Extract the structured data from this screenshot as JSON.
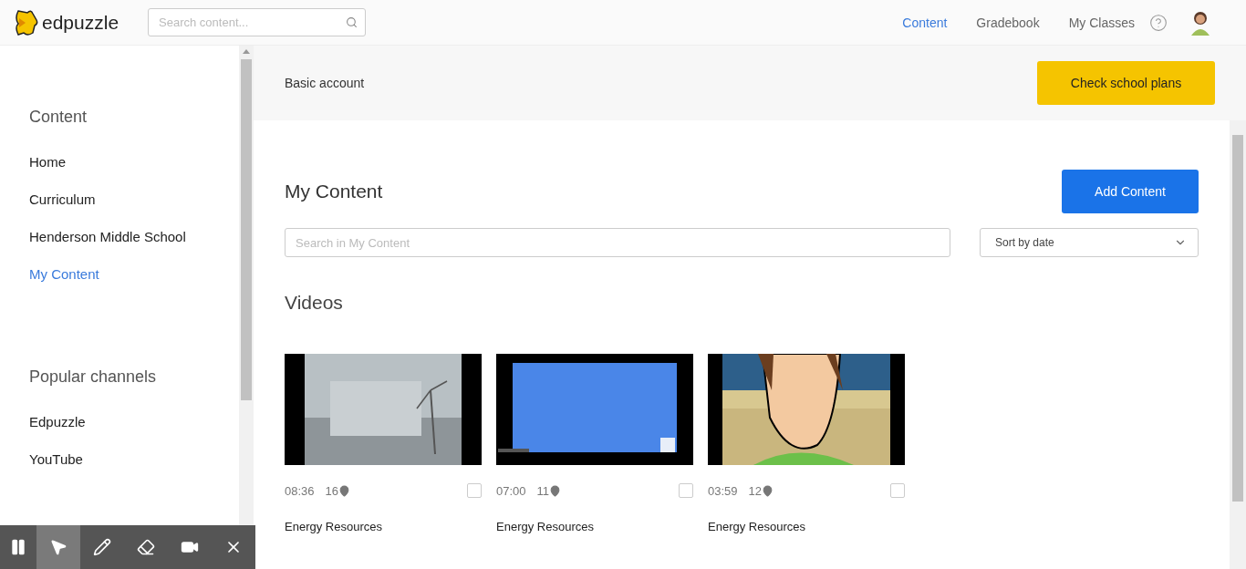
{
  "header": {
    "logo": "edpuzzle",
    "search": {
      "placeholder": "Search content..."
    },
    "nav": [
      {
        "label": "Content",
        "selected": true
      },
      {
        "label": "Gradebook",
        "selected": false
      },
      {
        "label": "My Classes",
        "selected": false
      }
    ]
  },
  "sidebar": {
    "sections": [
      {
        "title": "Content",
        "items": [
          {
            "label": "Home",
            "selected": false
          },
          {
            "label": "Curriculum",
            "selected": false
          },
          {
            "label": "Henderson Middle School",
            "selected": false
          },
          {
            "label": "My Content",
            "selected": true
          }
        ]
      },
      {
        "title": "Popular channels",
        "items": [
          {
            "label": "Edpuzzle",
            "selected": false
          },
          {
            "label": "YouTube",
            "selected": false
          }
        ]
      }
    ]
  },
  "banner": {
    "text": "Basic account",
    "button": "Check school plans"
  },
  "main": {
    "title": "My Content",
    "add_button": "Add Content",
    "search": {
      "placeholder": "Search in My Content"
    },
    "sort": "Sort by date",
    "section": "Videos",
    "videos": [
      {
        "duration": "08:36",
        "questions": "16",
        "title": "Energy Resources",
        "checked": false,
        "kind": "grey"
      },
      {
        "duration": "07:00",
        "questions": "11",
        "title": "Energy Resources",
        "checked": false,
        "kind": "slide"
      },
      {
        "duration": "03:59",
        "questions": "12",
        "title": "Energy Resources",
        "checked": false,
        "kind": "cartoon"
      }
    ]
  },
  "toolbar": [
    {
      "kind": "pause",
      "selected": false
    },
    {
      "kind": "pointer",
      "selected": true
    },
    {
      "kind": "pen",
      "selected": false
    },
    {
      "kind": "eraser",
      "selected": false
    },
    {
      "kind": "camera",
      "selected": false
    },
    {
      "kind": "close",
      "selected": false
    }
  ]
}
